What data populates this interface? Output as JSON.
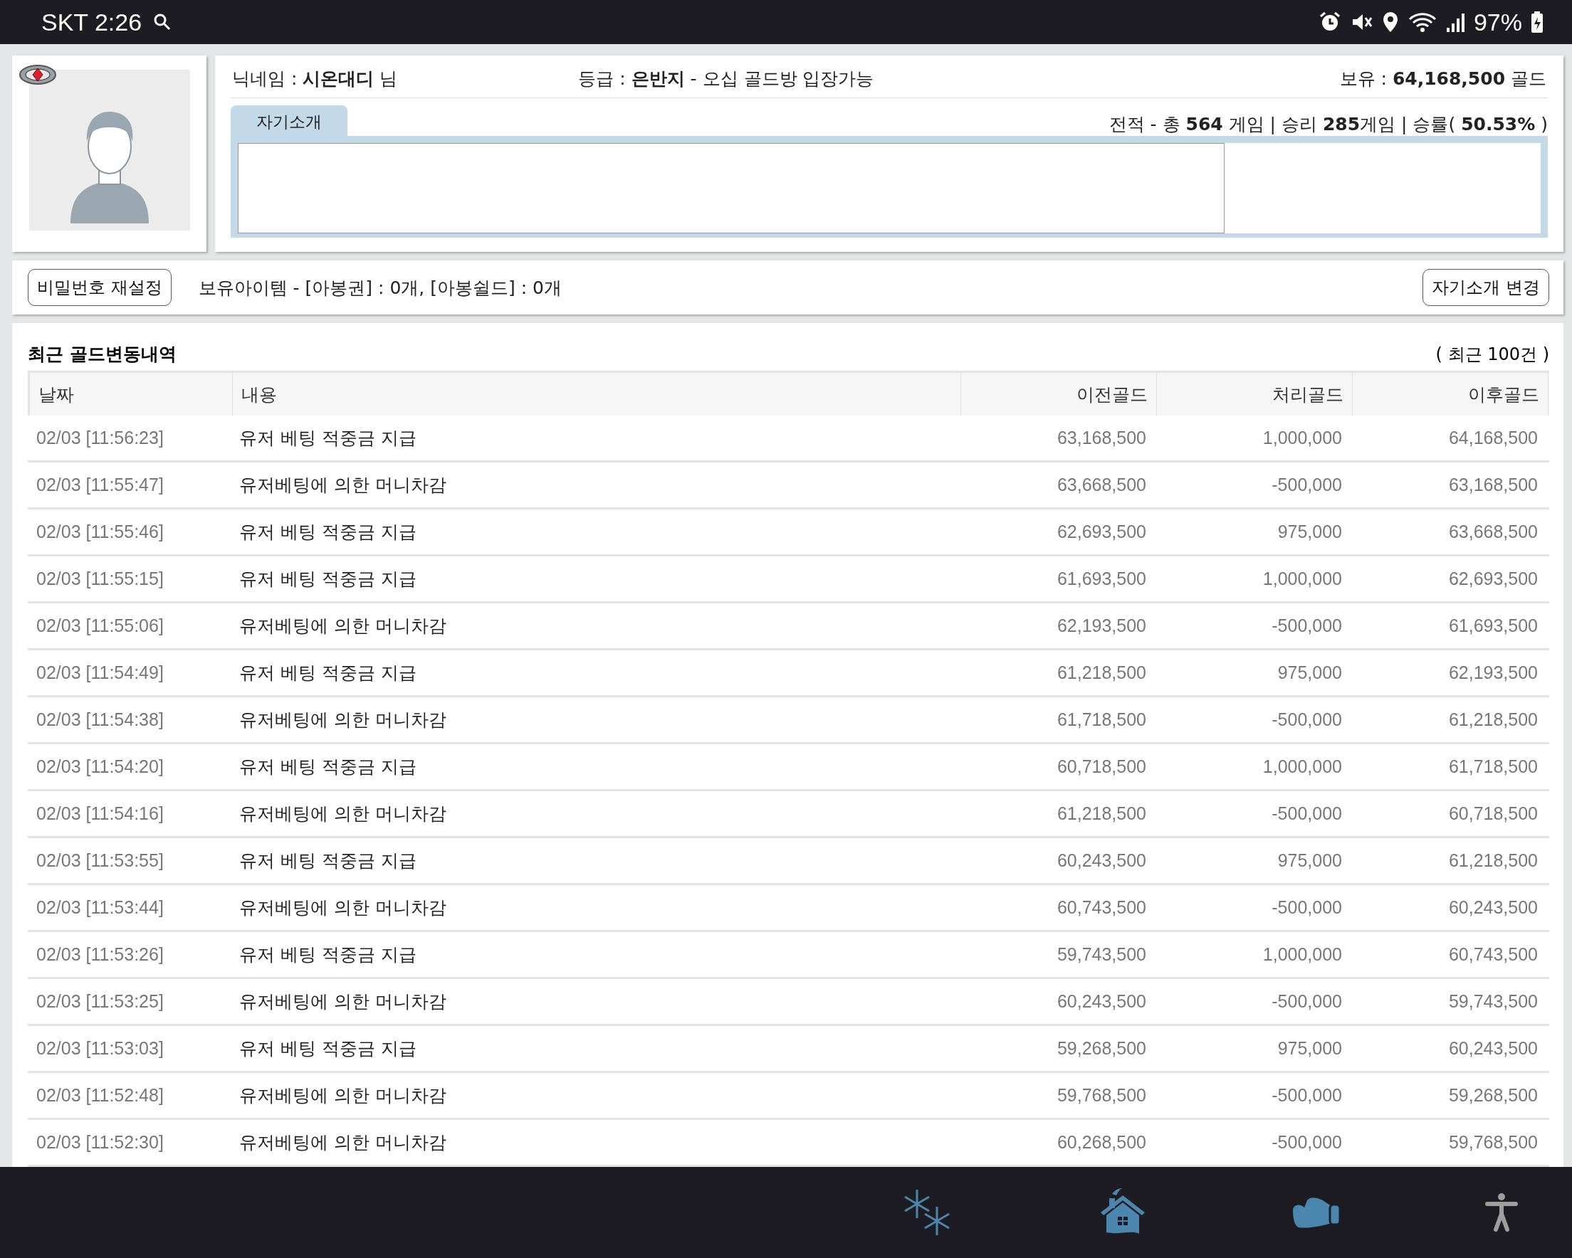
{
  "status_bar": {
    "carrier_time": "SKT 2:26",
    "battery": "97%"
  },
  "profile": {
    "nickname": "닉네임 : **시온대디** 님",
    "grade": "등급 : **은반지** - 오십 골드방 입장가능",
    "gold": "보유 : **64,168,500** 골드",
    "record": "전적 - 총 **564** 게임 | 승리 **285**게임 | 승률( **50.53%** )",
    "intro_tab": {
      "label": "자기소개",
      "selected": true
    }
  },
  "actions": {
    "reset_password": "비밀번호 재설정",
    "items": "보유아이템 - [아봉권] : 0개, [아봉쉴드] : 0개",
    "change_intro": "자기소개 변경"
  },
  "history": {
    "title": "최근 골드변동내역",
    "count": "( 최근 100건 )",
    "columns": [
      "날짜",
      "내용",
      "이전골드",
      "처리골드",
      "이후골드"
    ],
    "rows": [
      [
        "02/03 [11:56:23]",
        "유저 베팅 적중금 지급",
        "63,168,500",
        "1,000,000",
        "64,168,500"
      ],
      [
        "02/03 [11:55:47]",
        "유저베팅에 의한 머니차감",
        "63,668,500",
        "-500,000",
        "63,168,500"
      ],
      [
        "02/03 [11:55:46]",
        "유저 베팅 적중금 지급",
        "62,693,500",
        "975,000",
        "63,668,500"
      ],
      [
        "02/03 [11:55:15]",
        "유저 베팅 적중금 지급",
        "61,693,500",
        "1,000,000",
        "62,693,500"
      ],
      [
        "02/03 [11:55:06]",
        "유저베팅에 의한 머니차감",
        "62,193,500",
        "-500,000",
        "61,693,500"
      ],
      [
        "02/03 [11:54:49]",
        "유저 베팅 적중금 지급",
        "61,218,500",
        "975,000",
        "62,193,500"
      ],
      [
        "02/03 [11:54:38]",
        "유저베팅에 의한 머니차감",
        "61,718,500",
        "-500,000",
        "61,218,500"
      ],
      [
        "02/03 [11:54:20]",
        "유저 베팅 적중금 지급",
        "60,718,500",
        "1,000,000",
        "61,718,500"
      ],
      [
        "02/03 [11:54:16]",
        "유저베팅에 의한 머니차감",
        "61,218,500",
        "-500,000",
        "60,718,500"
      ],
      [
        "02/03 [11:53:55]",
        "유저 베팅 적중금 지급",
        "60,243,500",
        "975,000",
        "61,218,500"
      ],
      [
        "02/03 [11:53:44]",
        "유저베팅에 의한 머니차감",
        "60,743,500",
        "-500,000",
        "60,243,500"
      ],
      [
        "02/03 [11:53:26]",
        "유저 베팅 적중금 지급",
        "59,743,500",
        "1,000,000",
        "60,743,500"
      ],
      [
        "02/03 [11:53:25]",
        "유저베팅에 의한 머니차감",
        "60,243,500",
        "-500,000",
        "59,743,500"
      ],
      [
        "02/03 [11:53:03]",
        "유저 베팅 적중금 지급",
        "59,268,500",
        "975,000",
        "60,243,500"
      ],
      [
        "02/03 [11:52:48]",
        "유저베팅에 의한 머니차감",
        "59,768,500",
        "-500,000",
        "59,268,500"
      ],
      [
        "02/03 [11:52:30]",
        "유저베팅에 의한 머니차감",
        "60,268,500",
        "-500,000",
        "59,768,500"
      ]
    ]
  }
}
